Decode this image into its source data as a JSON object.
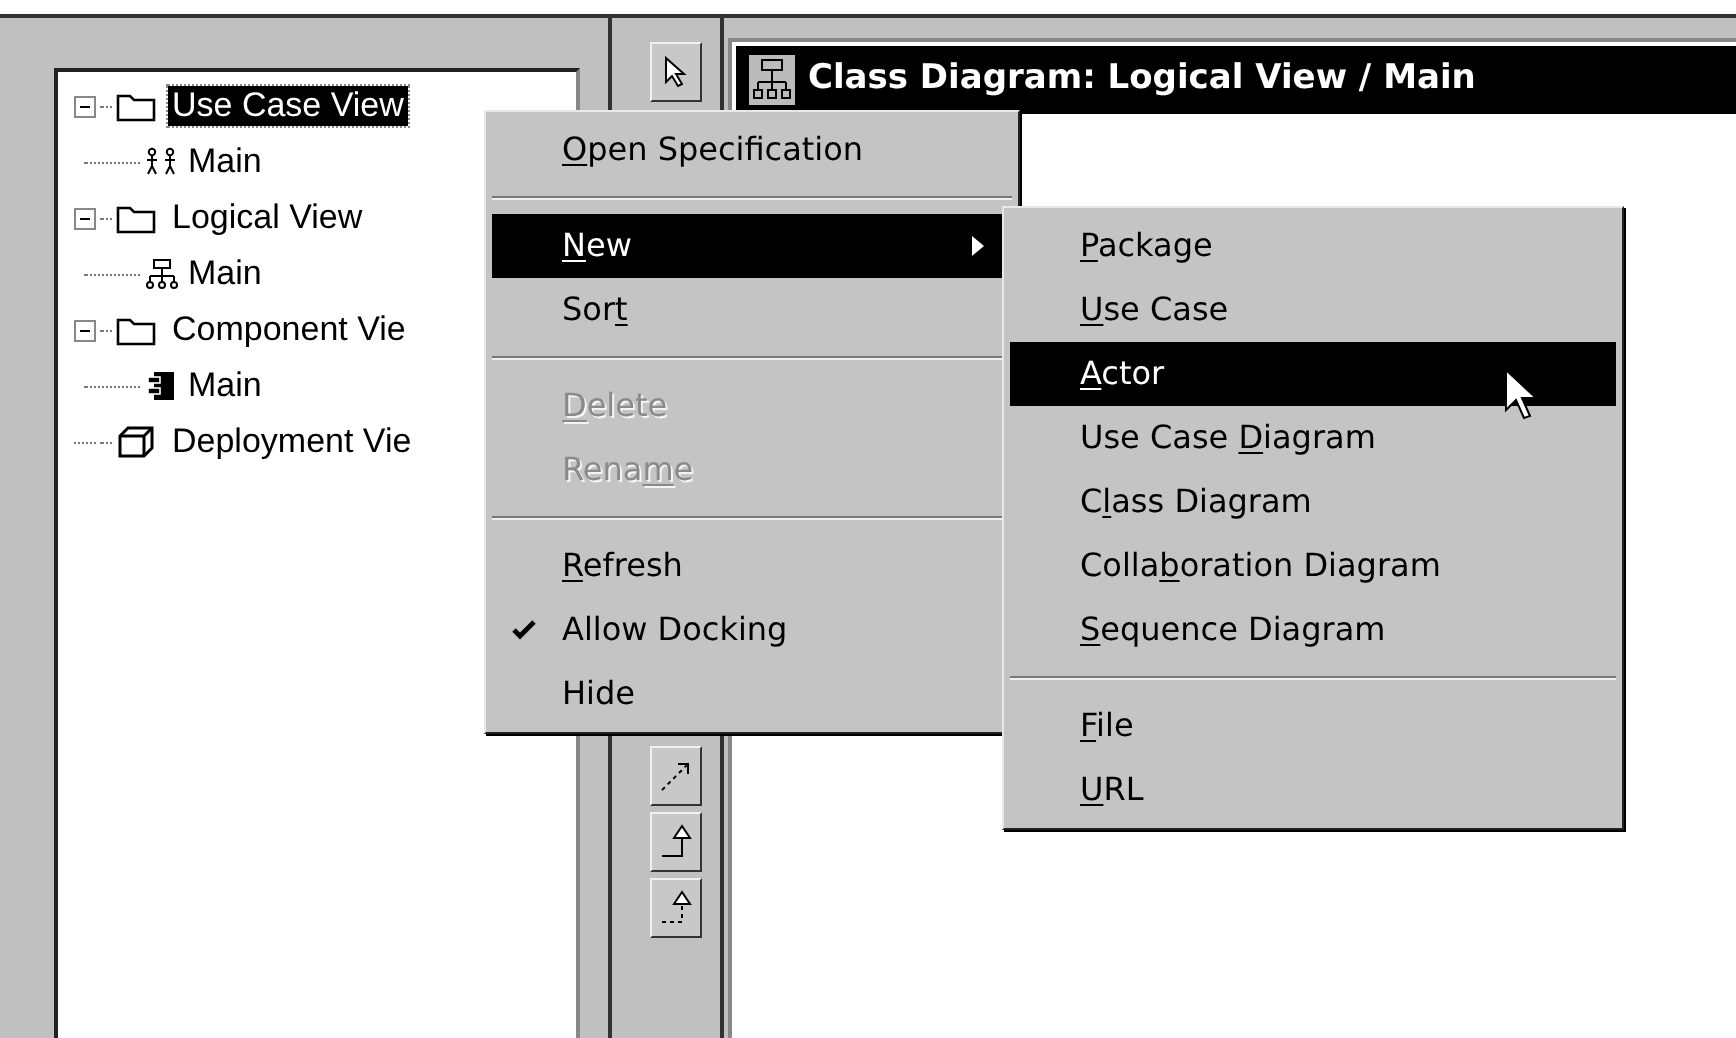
{
  "browser": {
    "tree": [
      {
        "label": "Use Case View",
        "kind": "folder",
        "selected": true,
        "expanded": true,
        "children": [
          {
            "label": "Main",
            "kind": "use-case-diagram",
            "selected": false
          }
        ]
      },
      {
        "label": "Logical View",
        "kind": "folder",
        "selected": false,
        "expanded": true,
        "children": [
          {
            "label": "Main",
            "kind": "class-diagram",
            "selected": false
          }
        ]
      },
      {
        "label": "Component Vie",
        "kind": "folder",
        "selected": false,
        "expanded": true,
        "children": [
          {
            "label": "Main",
            "kind": "component-diagram",
            "selected": false
          }
        ]
      },
      {
        "label": "Deployment Vie",
        "kind": "deployment",
        "selected": false
      }
    ]
  },
  "diagram_window": {
    "title": "Class Diagram: Logical View / Main"
  },
  "context_menu": [
    {
      "kind": "item",
      "key": "O",
      "post": "pen Specification",
      "selected": false,
      "disabled": false,
      "checked": false
    },
    {
      "kind": "separator"
    },
    {
      "kind": "item",
      "key": "N",
      "post": "ew",
      "selected": true,
      "disabled": false,
      "checked": false,
      "children": [
        {
          "kind": "item",
          "key": "P",
          "post": "ackage",
          "selected": false,
          "disabled": false,
          "checked": false
        },
        {
          "kind": "item",
          "key": "U",
          "post": "se Case",
          "selected": false,
          "disabled": false,
          "checked": false
        },
        {
          "kind": "item",
          "key": "A",
          "post": "ctor",
          "selected": true,
          "disabled": false,
          "checked": false
        },
        {
          "kind": "item",
          "pre": "Use Case ",
          "key": "D",
          "post": "iagram",
          "selected": false,
          "disabled": false,
          "checked": false
        },
        {
          "kind": "item",
          "pre": "C",
          "key": "l",
          "post": "ass Diagram",
          "selected": false,
          "disabled": false,
          "checked": false
        },
        {
          "kind": "item",
          "pre": "Colla",
          "key": "b",
          "post": "oration Diagram",
          "selected": false,
          "disabled": false,
          "checked": false
        },
        {
          "kind": "item",
          "key": "S",
          "post": "equence Diagram",
          "selected": false,
          "disabled": false,
          "checked": false
        },
        {
          "kind": "separator"
        },
        {
          "kind": "item",
          "key": "F",
          "post": "ile",
          "selected": false,
          "disabled": false,
          "checked": false
        },
        {
          "kind": "item",
          "key": "U",
          "post": "RL",
          "selected": false,
          "disabled": false,
          "checked": false
        }
      ]
    },
    {
      "kind": "item",
      "pre": "Sor",
      "key": "t",
      "selected": false,
      "disabled": false,
      "checked": false
    },
    {
      "kind": "separator"
    },
    {
      "kind": "item",
      "key": "D",
      "post": "elete",
      "selected": false,
      "disabled": true,
      "checked": false
    },
    {
      "kind": "item",
      "pre": "Rena",
      "key": "m",
      "post": "e",
      "selected": false,
      "disabled": true,
      "checked": false
    },
    {
      "kind": "separator"
    },
    {
      "kind": "item",
      "key": "R",
      "post": "efresh",
      "selected": false,
      "disabled": false,
      "checked": false
    },
    {
      "kind": "item",
      "pre": "Allow Docking",
      "selected": false,
      "disabled": false,
      "checked": true
    },
    {
      "kind": "item",
      "pre": "Hide",
      "selected": false,
      "disabled": false,
      "checked": false
    }
  ]
}
